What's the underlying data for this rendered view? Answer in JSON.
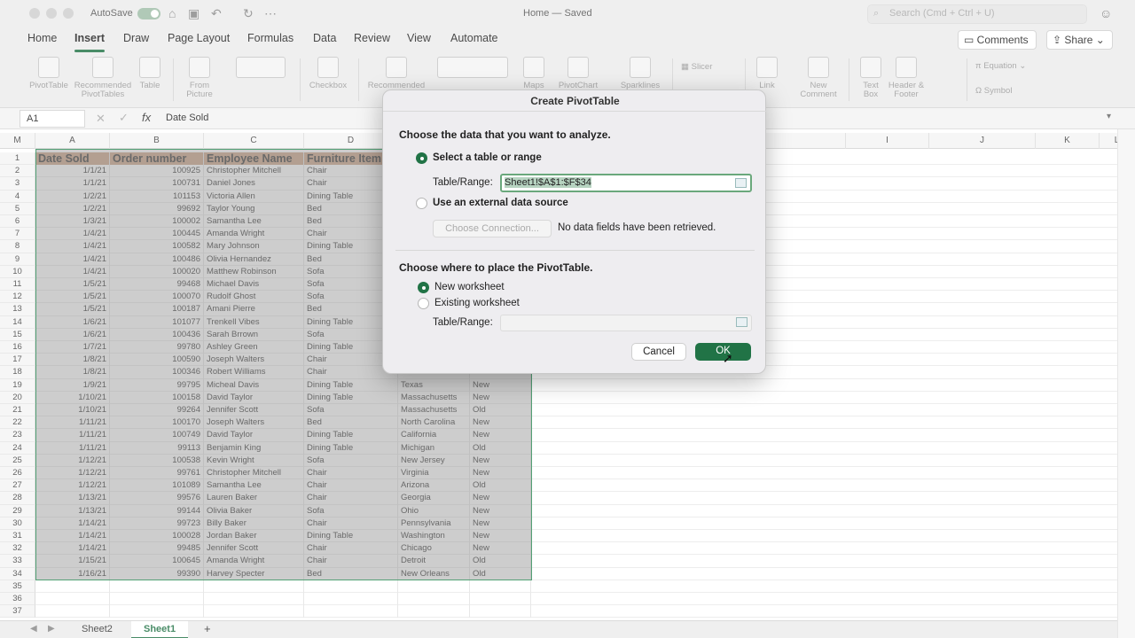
{
  "titlebar": {
    "autosave_label": "AutoSave",
    "doc_title": "Home — Saved",
    "search_placeholder": "Search (Cmd + Ctrl + U)"
  },
  "ribbon_tabs": [
    "Home",
    "Insert",
    "Draw",
    "Page Layout",
    "Formulas",
    "Data",
    "Review",
    "View",
    "Automate"
  ],
  "active_tab": "Insert",
  "comments_label": "Comments",
  "share_label": "Share",
  "ribbon": {
    "pivot_table": "PivotTable",
    "recommended_pivot_1": "Recommended",
    "recommended_pivot_2": "PivotTables",
    "table": "Table",
    "from_picture_1": "From",
    "from_picture_2": "Picture",
    "checkbox": "Checkbox",
    "recommended": "Recommended",
    "maps": "Maps",
    "pivot_chart": "PivotChart",
    "sparklines": "Sparklines",
    "slicer": "Slicer",
    "link": "Link",
    "new_comment_1": "New",
    "new_comment_2": "Comment",
    "text_box_1": "Text",
    "text_box_2": "Box",
    "header_footer_1": "Header &",
    "header_footer_2": "Footer",
    "equation": "Equation",
    "symbol": "Symbol"
  },
  "formula_bar": {
    "name_box": "A1",
    "formula": "Date Sold"
  },
  "columns": [
    "A",
    "B",
    "C",
    "D",
    "",
    "",
    "",
    "",
    "",
    "I",
    "J",
    "K",
    "L",
    "M"
  ],
  "header_row": [
    "Date Sold",
    "Order number",
    "Employee Name",
    "Furniture Item"
  ],
  "rows": [
    [
      "1/1/21",
      "100925",
      "Christopher Mitchell",
      "Chair",
      "",
      ""
    ],
    [
      "1/1/21",
      "100731",
      "Daniel Jones",
      "Chair",
      "",
      ""
    ],
    [
      "1/2/21",
      "101153",
      "Victoria Allen",
      "Dining Table",
      "",
      ""
    ],
    [
      "1/2/21",
      "99692",
      "Taylor Young",
      "Bed",
      "",
      ""
    ],
    [
      "1/3/21",
      "100002",
      "Samantha Lee",
      "Bed",
      "",
      ""
    ],
    [
      "1/4/21",
      "100445",
      "Amanda Wright",
      "Chair",
      "",
      ""
    ],
    [
      "1/4/21",
      "100582",
      "Mary Johnson",
      "Dining Table",
      "",
      ""
    ],
    [
      "1/4/21",
      "100486",
      "Olivia Hernandez",
      "Bed",
      "",
      ""
    ],
    [
      "1/4/21",
      "100020",
      "Matthew Robinson",
      "Sofa",
      "",
      ""
    ],
    [
      "1/5/21",
      "99468",
      "Michael Davis",
      "Sofa",
      "",
      ""
    ],
    [
      "1/5/21",
      "100070",
      "Rudolf Ghost",
      "Sofa",
      "",
      ""
    ],
    [
      "1/5/21",
      "100187",
      "Amani Pierre",
      "Bed",
      "",
      ""
    ],
    [
      "1/6/21",
      "101077",
      "Trenkell Vibes",
      "Dining Table",
      "",
      ""
    ],
    [
      "1/6/21",
      "100436",
      "Sarah Brrown",
      "Sofa",
      "",
      ""
    ],
    [
      "1/7/21",
      "99780",
      "Ashley Green",
      "Dining Table",
      "",
      ""
    ],
    [
      "1/8/21",
      "100590",
      "Joseph Walters",
      "Chair",
      "",
      ""
    ],
    [
      "1/8/21",
      "100346",
      "Robert Williams",
      "Chair",
      "",
      ""
    ],
    [
      "1/9/21",
      "99795",
      "Micheal Davis",
      "Dining Table",
      "Texas",
      "New"
    ],
    [
      "1/10/21",
      "100158",
      "David Taylor",
      "Dining Table",
      "Massachusetts",
      "New"
    ],
    [
      "1/10/21",
      "99264",
      "Jennifer Scott",
      "Sofa",
      "Massachusetts",
      "Old"
    ],
    [
      "1/11/21",
      "100170",
      "Joseph Walters",
      "Bed",
      "North Carolina",
      "New"
    ],
    [
      "1/11/21",
      "100749",
      "David Taylor",
      "Dining Table",
      "California",
      "New"
    ],
    [
      "1/11/21",
      "99113",
      "Benjamin King",
      "Dining Table",
      "Michigan",
      "Old"
    ],
    [
      "1/12/21",
      "100538",
      "Kevin Wright",
      "Sofa",
      "New Jersey",
      "New"
    ],
    [
      "1/12/21",
      "99761",
      "Christopher Mitchell",
      "Chair",
      "Virginia",
      "New"
    ],
    [
      "1/12/21",
      "101089",
      "Samantha Lee",
      "Chair",
      "Arizona",
      "Old"
    ],
    [
      "1/13/21",
      "99576",
      "Lauren Baker",
      "Chair",
      "Georgia",
      "New"
    ],
    [
      "1/13/21",
      "99144",
      "Olivia Baker",
      "Sofa",
      "Ohio",
      "New"
    ],
    [
      "1/14/21",
      "99723",
      "Billy Baker",
      "Chair",
      "Pennsylvania",
      "New"
    ],
    [
      "1/14/21",
      "100028",
      "Jordan Baker",
      "Dining Table",
      "Washington",
      "New"
    ],
    [
      "1/14/21",
      "99485",
      "Jennifer Scott",
      "Chair",
      "Chicago",
      "New"
    ],
    [
      "1/15/21",
      "100645",
      "Amanda Wright",
      "Chair",
      "Detroit",
      "Old"
    ],
    [
      "1/16/21",
      "99390",
      "Harvey Specter",
      "Bed",
      "New Orleans",
      "Old"
    ]
  ],
  "row_numbers": [
    "1",
    "2",
    "3",
    "4",
    "5",
    "6",
    "7",
    "8",
    "9",
    "10",
    "11",
    "12",
    "13",
    "14",
    "15",
    "16",
    "17",
    "18",
    "19",
    "20",
    "21",
    "22",
    "23",
    "24",
    "25",
    "26",
    "27",
    "28",
    "29",
    "30",
    "31",
    "32",
    "33",
    "34",
    "35",
    "36",
    "37"
  ],
  "sheets": [
    "Sheet2",
    "Sheet1"
  ],
  "active_sheet": "Sheet1",
  "add_sheet": "+",
  "dialog": {
    "title": "Create PivotTable",
    "section1_heading": "Choose the data that you want to analyze.",
    "option_table": "Select a table or range",
    "table_range_label": "Table/Range:",
    "table_range_value": "Sheet1!$A$1:$F$34",
    "option_external": "Use an external data source",
    "choose_connection": "Choose Connection...",
    "no_fields": "No data fields have been retrieved.",
    "section2_heading": "Choose where to place the PivotTable.",
    "option_new_ws": "New worksheet",
    "option_existing_ws": "Existing worksheet",
    "table_range_label2": "Table/Range:",
    "table_range_value2": "",
    "cancel": "Cancel",
    "ok": "OK"
  },
  "colors": {
    "accent": "#217346",
    "header_fill": "#c69a7a"
  }
}
